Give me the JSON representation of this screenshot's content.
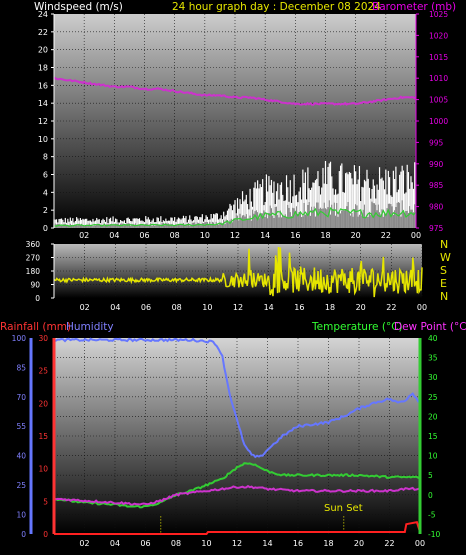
{
  "header": {
    "left": "Windspeed (m/s)",
    "center": "24 hour graph day : December 08 2024",
    "right": "Barometer (mb)"
  },
  "lower_header": {
    "rainfall": "Rainfall (mm)",
    "humidity": "Humidity",
    "temperature": "Temperature (°C)",
    "dewpoint": "Dew Point (°C)"
  },
  "annotation": {
    "sunset": "Sun Set"
  },
  "compass": [
    "N",
    "W",
    "S",
    "E",
    "N"
  ],
  "colors": {
    "wind": "#e6e6e6",
    "gust": "#ffffff",
    "avg_wind": "#33cc33",
    "barometer": "#cc33cc",
    "direction": "#e6e600",
    "humidity": "#6677ff",
    "temperature": "#33cc33",
    "dewpoint": "#cc33cc",
    "rain": "#ff2020",
    "label_wind": "#ffffff",
    "label_title": "#e6e600",
    "label_baro": "#e600e6",
    "label_rain": "#ff3333",
    "label_humidity": "#8080ff",
    "label_temp": "#33ff33",
    "label_dew": "#ff33ff"
  },
  "chart_data": [
    {
      "type": "line",
      "name": "wind-barometer",
      "x": [
        "02",
        "04",
        "06",
        "08",
        "10",
        "12",
        "14",
        "16",
        "18",
        "20",
        "22",
        "00"
      ],
      "ylim_left": [
        0,
        24
      ],
      "yticks_left": [
        0,
        2,
        4,
        6,
        8,
        10,
        12,
        14,
        16,
        18,
        20,
        22,
        24
      ],
      "ylim_right": [
        975,
        1025
      ],
      "yticks_right": [
        975,
        980,
        985,
        990,
        995,
        1000,
        1005,
        1010,
        1015,
        1020,
        1025
      ],
      "series": [
        {
          "name": "Barometer",
          "axis": "right",
          "values": [
            [
              0,
              1010
            ],
            [
              1,
              1009.5
            ],
            [
              2,
              1009
            ],
            [
              3,
              1008.5
            ],
            [
              4,
              1008
            ],
            [
              5,
              1008
            ],
            [
              6,
              1007.5
            ],
            [
              7,
              1007.5
            ],
            [
              8,
              1007
            ],
            [
              9,
              1006.5
            ],
            [
              10,
              1006
            ],
            [
              11,
              1006
            ],
            [
              12,
              1005.5
            ],
            [
              13,
              1005.5
            ],
            [
              14,
              1005
            ],
            [
              15,
              1004.5
            ],
            [
              16,
              1004
            ],
            [
              17,
              1004
            ],
            [
              18,
              1004
            ],
            [
              19,
              1004
            ],
            [
              20,
              1004
            ],
            [
              21,
              1004.5
            ],
            [
              22,
              1005
            ],
            [
              23,
              1005.5
            ],
            [
              24,
              1005.5
            ]
          ]
        }
      ],
      "wind_profile": [
        [
          0,
          0.5
        ],
        [
          9,
          0.6
        ],
        [
          11,
          0.8
        ],
        [
          12,
          1.5
        ],
        [
          14,
          2.5
        ],
        [
          16,
          2.8
        ],
        [
          18,
          3.2
        ],
        [
          20,
          3.0
        ],
        [
          22,
          3.0
        ],
        [
          24,
          3.2
        ]
      ],
      "grid": true
    },
    {
      "type": "scatter",
      "name": "wind-direction",
      "x": [
        "02",
        "04",
        "06",
        "08",
        "10",
        "12",
        "14",
        "16",
        "18",
        "20",
        "22",
        "00"
      ],
      "ylim": [
        0,
        360
      ],
      "yticks": [
        0,
        90,
        180,
        270,
        360
      ],
      "base_direction": 120
    },
    {
      "type": "line",
      "name": "temp-humidity-rain",
      "x": [
        "02",
        "04",
        "06",
        "08",
        "10",
        "12",
        "14",
        "16",
        "18",
        "20",
        "22",
        "00"
      ],
      "ylim_humidity": [
        0,
        100
      ],
      "yticks_humidity": [
        0,
        10,
        25,
        40,
        55,
        70,
        85,
        100
      ],
      "ylim_rain": [
        0,
        30
      ],
      "yticks_rain": [
        0,
        5,
        10,
        15,
        20,
        25,
        30
      ],
      "ylim_temp": [
        -10,
        40
      ],
      "yticks_temp": [
        -10,
        -5,
        0,
        5,
        10,
        15,
        20,
        25,
        30,
        35,
        40
      ],
      "series": [
        {
          "name": "Humidity",
          "axis": "humidity",
          "values": [
            [
              0,
              99
            ],
            [
              7,
              99
            ],
            [
              9,
              99
            ],
            [
              10.5,
              98
            ],
            [
              11,
              92
            ],
            [
              11.5,
              72
            ],
            [
              12,
              58
            ],
            [
              12.5,
              45
            ],
            [
              13,
              40
            ],
            [
              13.5,
              39
            ],
            [
              14,
              43
            ],
            [
              15,
              50
            ],
            [
              16,
              55
            ],
            [
              17,
              56
            ],
            [
              18,
              57
            ],
            [
              19,
              60
            ],
            [
              20,
              64
            ],
            [
              21,
              67
            ],
            [
              22,
              69
            ],
            [
              22.5,
              67
            ],
            [
              23,
              68
            ],
            [
              23.5,
              72
            ],
            [
              24,
              67
            ]
          ]
        },
        {
          "name": "Temperature",
          "axis": "temp",
          "values": [
            [
              0,
              -1
            ],
            [
              2,
              -2
            ],
            [
              4,
              -2.5
            ],
            [
              5,
              -3
            ],
            [
              6,
              -3
            ],
            [
              7,
              -2
            ],
            [
              8,
              0
            ],
            [
              9,
              1
            ],
            [
              10,
              2.5
            ],
            [
              11,
              4
            ],
            [
              12,
              7
            ],
            [
              12.5,
              8
            ],
            [
              13,
              8
            ],
            [
              14,
              6
            ],
            [
              15,
              5
            ],
            [
              16,
              5
            ],
            [
              18,
              5
            ],
            [
              20,
              5
            ],
            [
              22,
              4.5
            ],
            [
              24,
              4.5
            ]
          ]
        },
        {
          "name": "Dew Point",
          "axis": "temp",
          "values": [
            [
              0,
              -1
            ],
            [
              2,
              -1.5
            ],
            [
              4,
              -2
            ],
            [
              6,
              -2.5
            ],
            [
              7,
              -1.5
            ],
            [
              8,
              0
            ],
            [
              9,
              0.5
            ],
            [
              10,
              1
            ],
            [
              11,
              1.5
            ],
            [
              12,
              2
            ],
            [
              13,
              2
            ],
            [
              14,
              1.5
            ],
            [
              16,
              1
            ],
            [
              18,
              1
            ],
            [
              20,
              1
            ],
            [
              22,
              1
            ],
            [
              23,
              1.5
            ],
            [
              24,
              1.5
            ]
          ]
        },
        {
          "name": "Rainfall",
          "axis": "rain",
          "values": [
            [
              0,
              0
            ],
            [
              10,
              0
            ],
            [
              10.1,
              0.3
            ],
            [
              23,
              0.3
            ],
            [
              23.1,
              1.5
            ],
            [
              23.8,
              1.8
            ],
            [
              24,
              0.3
            ]
          ]
        }
      ],
      "sunrise_hour": 7,
      "sunset_hour": 19,
      "grid": true
    }
  ]
}
